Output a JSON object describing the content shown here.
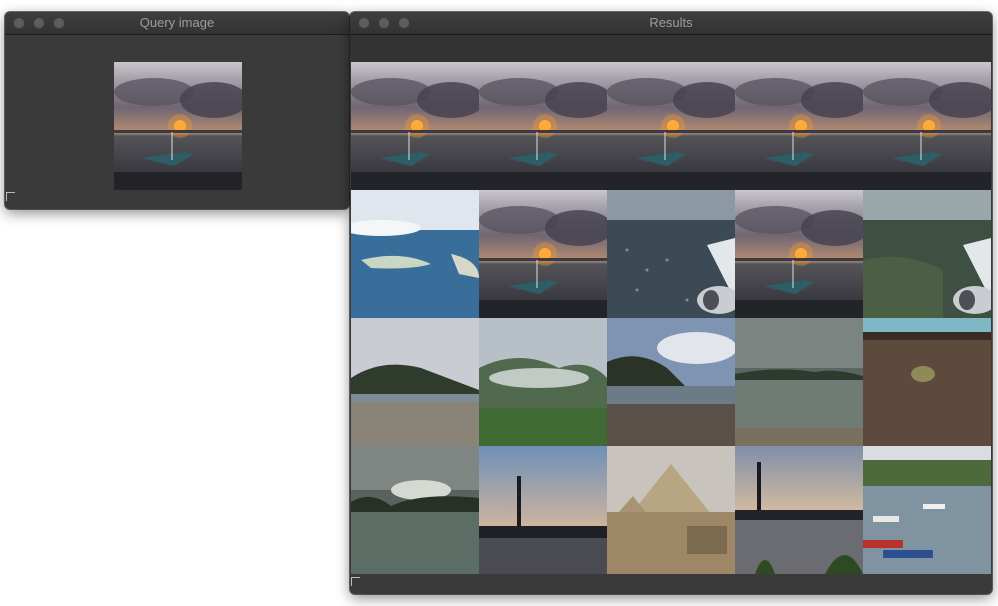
{
  "query_window": {
    "title": "Query image"
  },
  "results_window": {
    "title": "Results"
  },
  "query_thumbnail": {
    "scene": "boat-sunset"
  },
  "results": [
    {
      "scene": "boat-sunset"
    },
    {
      "scene": "boat-sunset"
    },
    {
      "scene": "boat-sunset"
    },
    {
      "scene": "boat-sunset"
    },
    {
      "scene": "boat-sunset"
    },
    {
      "scene": "aerial-island"
    },
    {
      "scene": "boat-sunset"
    },
    {
      "scene": "aerial-wing"
    },
    {
      "scene": "boat-sunset"
    },
    {
      "scene": "aerial-wing-green"
    },
    {
      "scene": "coast-hill"
    },
    {
      "scene": "misty-mountains"
    },
    {
      "scene": "rocky-coast"
    },
    {
      "scene": "overcast-sea"
    },
    {
      "scene": "frog-wood"
    },
    {
      "scene": "storm-islands"
    },
    {
      "scene": "tower-dusk"
    },
    {
      "scene": "pyramids"
    },
    {
      "scene": "tower-river"
    },
    {
      "scene": "harbor-boats"
    }
  ]
}
